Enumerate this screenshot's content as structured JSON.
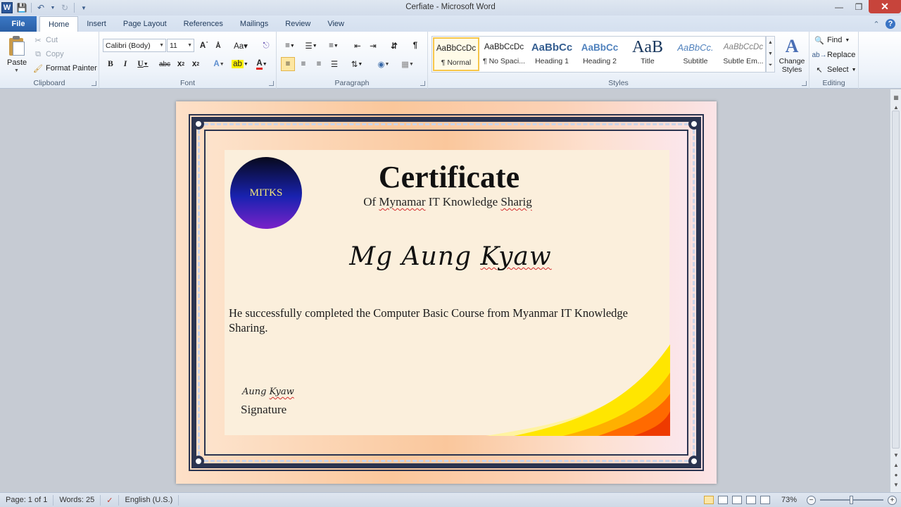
{
  "window": {
    "title": "Cerfiate  -  Microsoft Word",
    "app_icon": "W"
  },
  "tabs": [
    {
      "label": "File"
    },
    {
      "label": "Home"
    },
    {
      "label": "Insert"
    },
    {
      "label": "Page Layout"
    },
    {
      "label": "References"
    },
    {
      "label": "Mailings"
    },
    {
      "label": "Review"
    },
    {
      "label": "View"
    }
  ],
  "ribbon": {
    "clipboard": {
      "group_label": "Clipboard",
      "paste_label": "Paste",
      "cut_label": "Cut",
      "copy_label": "Copy",
      "format_painter_label": "Format Painter"
    },
    "font": {
      "group_label": "Font",
      "font_name": "Calibri (Body)",
      "font_size": "11"
    },
    "paragraph": {
      "group_label": "Paragraph"
    },
    "styles": {
      "group_label": "Styles",
      "items": [
        {
          "sample": "AaBbCcDc",
          "name": "¶ Normal"
        },
        {
          "sample": "AaBbCcDc",
          "name": "¶ No Spaci..."
        },
        {
          "sample": "AaBbCc",
          "name": "Heading 1"
        },
        {
          "sample": "AaBbCc",
          "name": "Heading 2"
        },
        {
          "sample": "AaB",
          "name": "Title"
        },
        {
          "sample": "AaBbCc.",
          "name": "Subtitle"
        },
        {
          "sample": "AaBbCcDc",
          "name": "Subtle Em..."
        }
      ],
      "change_styles_label_1": "Change",
      "change_styles_label_2": "Styles"
    },
    "editing": {
      "group_label": "Editing",
      "find_label": "Find",
      "replace_label": "Replace",
      "select_label": "Select"
    }
  },
  "document": {
    "seal_text": "MITKS",
    "title": "Certificate",
    "subtitle_prefix": "Of",
    "subtitle_word1": "Mynamar",
    "subtitle_mid": "IT  Knowledge",
    "subtitle_word2": "Sharig",
    "recipient_first": "Mg Aung",
    "recipient_last": "Kyaw",
    "body": "He successfully completed the Computer Basic Course from Myanmar IT Knowledge Sharing.",
    "signature_script_1": "Aung",
    "signature_script_2": "Kyaw",
    "signature_label": "Signature"
  },
  "status": {
    "page": "Page: 1 of 1",
    "words": "Words: 25",
    "language": "English (U.S.)",
    "zoom": "73%"
  },
  "colors": {
    "file_tab": "#2a5fa6",
    "close_button": "#c7443b",
    "border_navy": "#2b3450"
  }
}
